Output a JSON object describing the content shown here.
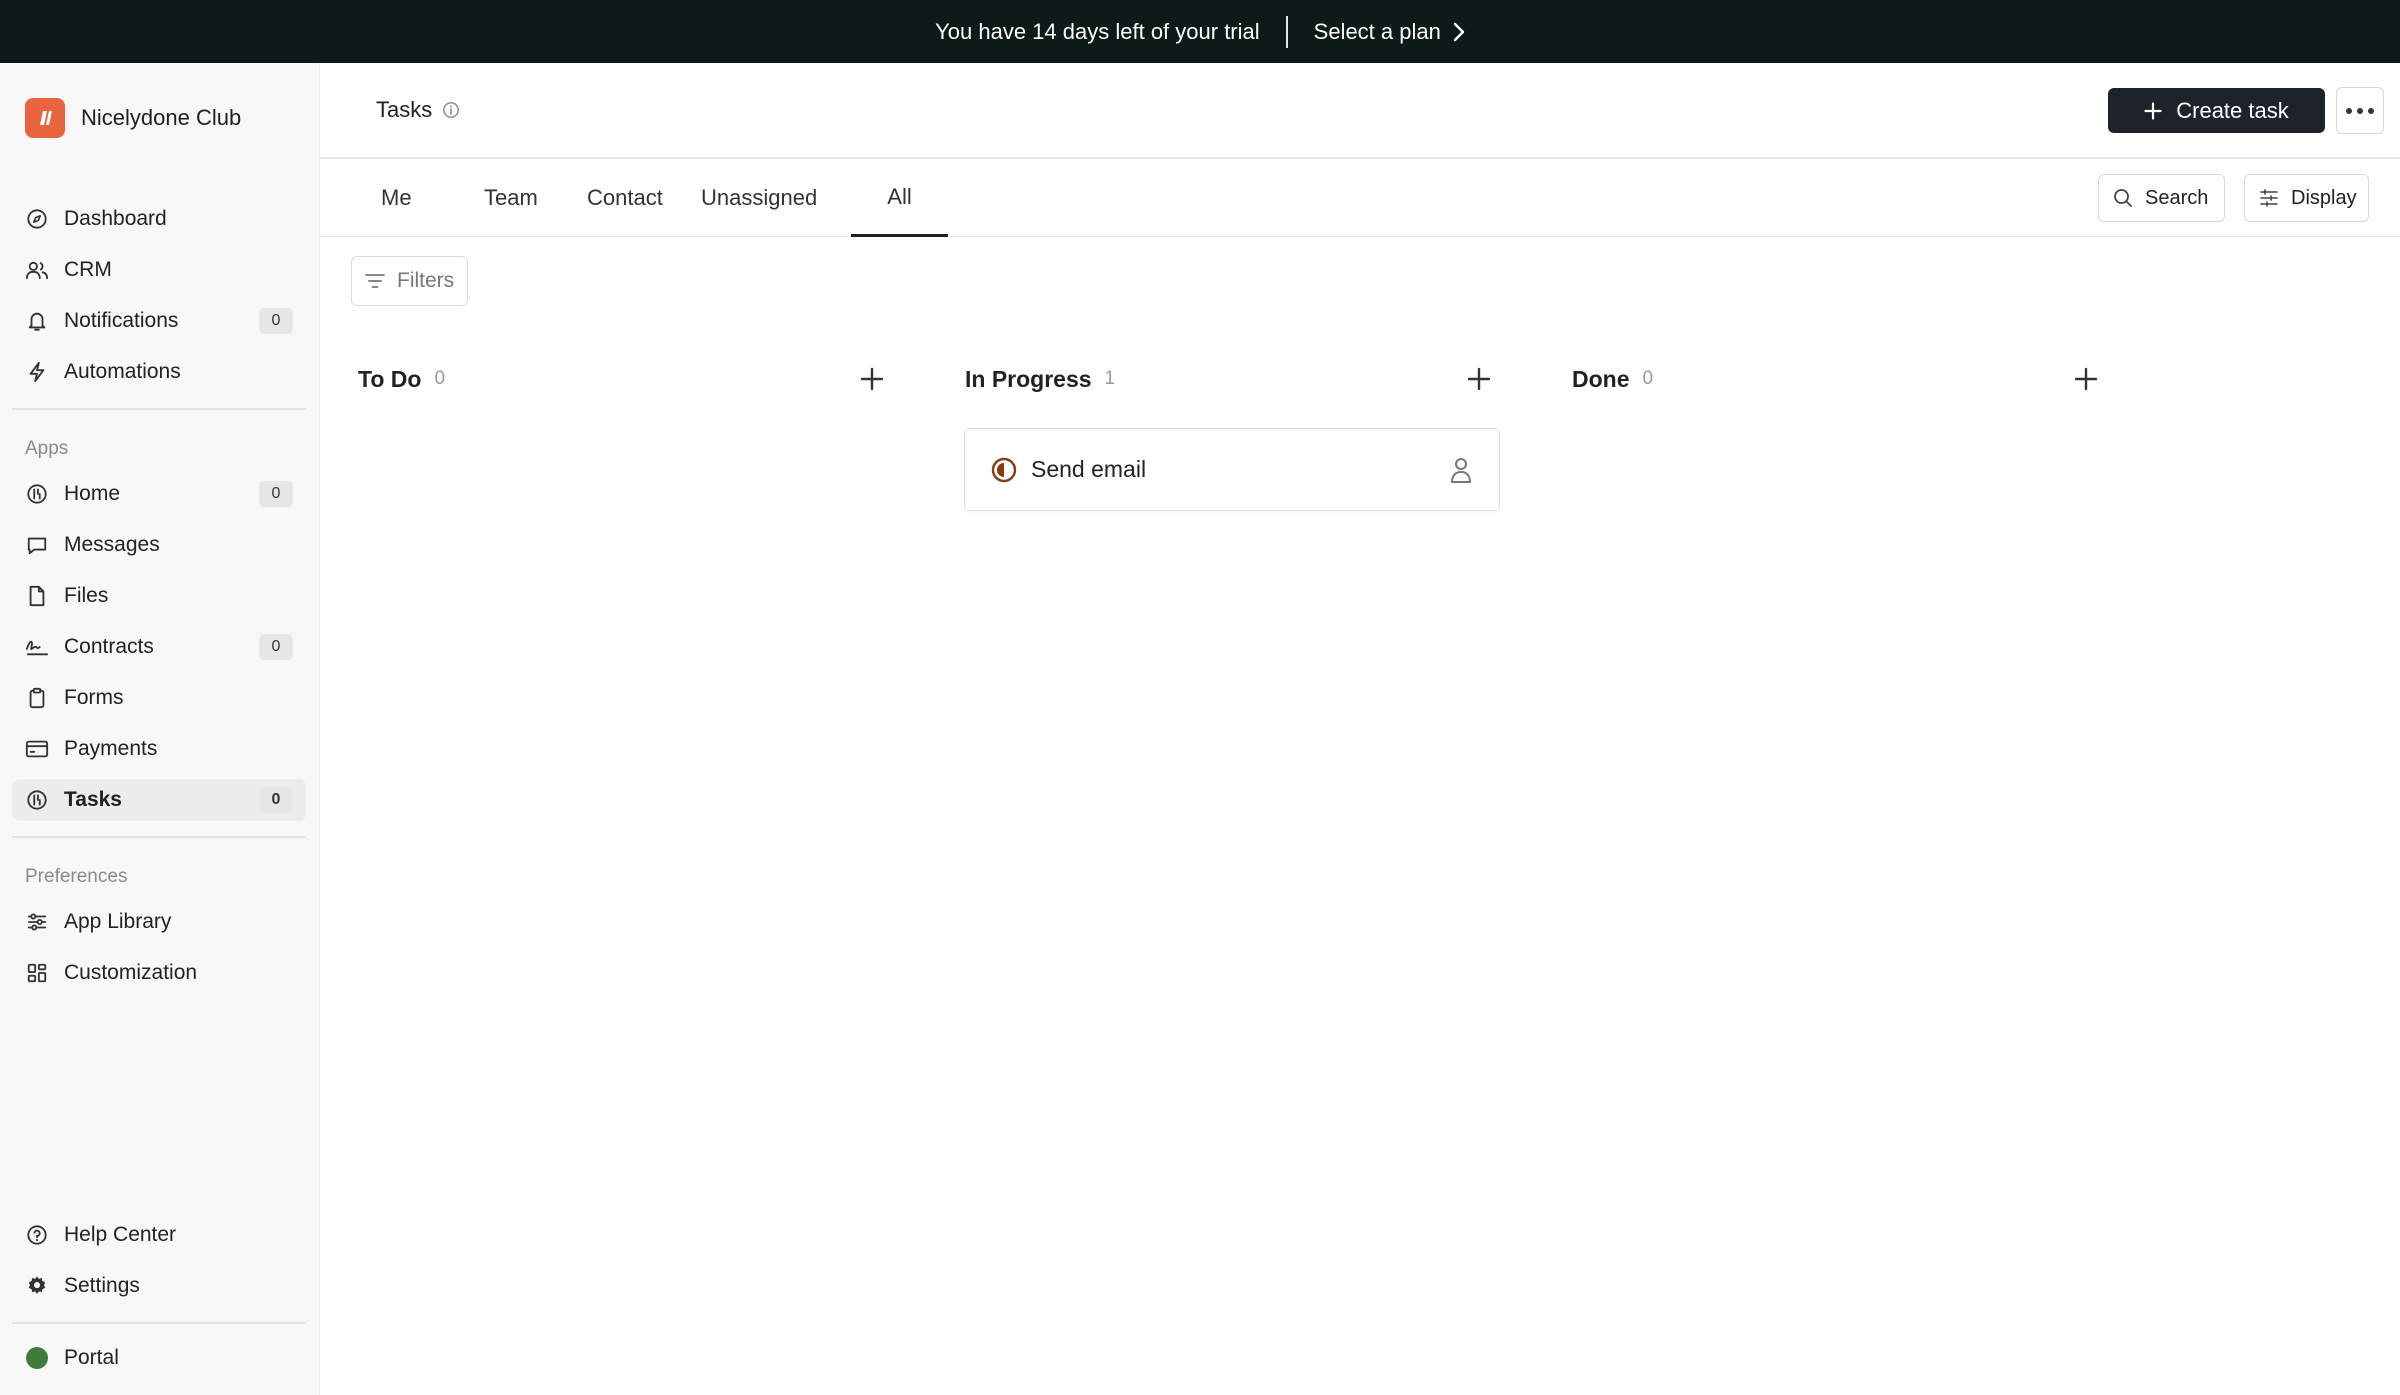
{
  "banner": {
    "message": "You have 14 days left of your trial",
    "cta": "Select a plan"
  },
  "brand": {
    "name": "Nicelydone Club",
    "logo_color": "#e8643c"
  },
  "sidebar": {
    "main_items": [
      {
        "label": "Dashboard",
        "icon": "compass-icon"
      },
      {
        "label": "CRM",
        "icon": "users-icon"
      },
      {
        "label": "Notifications",
        "icon": "bell-icon",
        "badge": "0"
      },
      {
        "label": "Automations",
        "icon": "lightning-icon"
      }
    ],
    "apps_label": "Apps",
    "app_items": [
      {
        "label": "Home",
        "icon": "home-app-icon",
        "badge": "0"
      },
      {
        "label": "Messages",
        "icon": "message-icon"
      },
      {
        "label": "Files",
        "icon": "file-icon"
      },
      {
        "label": "Contracts",
        "icon": "signature-icon",
        "badge": "0"
      },
      {
        "label": "Forms",
        "icon": "clipboard-icon"
      },
      {
        "label": "Payments",
        "icon": "credit-card-icon"
      },
      {
        "label": "Tasks",
        "icon": "tasks-app-icon",
        "badge": "0",
        "active": true
      }
    ],
    "preferences_label": "Preferences",
    "preference_items": [
      {
        "label": "App Library",
        "icon": "sliders-icon"
      },
      {
        "label": "Customization",
        "icon": "grid-icon"
      }
    ],
    "bottom_items": [
      {
        "label": "Help Center",
        "icon": "help-icon"
      },
      {
        "label": "Settings",
        "icon": "gear-icon"
      }
    ],
    "portal": {
      "label": "Portal",
      "color": "#3e7b3c"
    }
  },
  "header": {
    "title": "Tasks",
    "create_label": "Create task"
  },
  "tabs": [
    "Me",
    "Team",
    "Contact",
    "Unassigned",
    "All"
  ],
  "active_tab": "All",
  "toolbar": {
    "search_label": "Search",
    "display_label": "Display"
  },
  "filters_label": "Filters",
  "board": {
    "columns": [
      {
        "title": "To Do",
        "count": "0"
      },
      {
        "title": "In Progress",
        "count": "1"
      },
      {
        "title": "Done",
        "count": "0"
      }
    ],
    "cards": [
      {
        "column": "In Progress",
        "title": "Send email",
        "status_color": "#8a3a12"
      }
    ]
  }
}
